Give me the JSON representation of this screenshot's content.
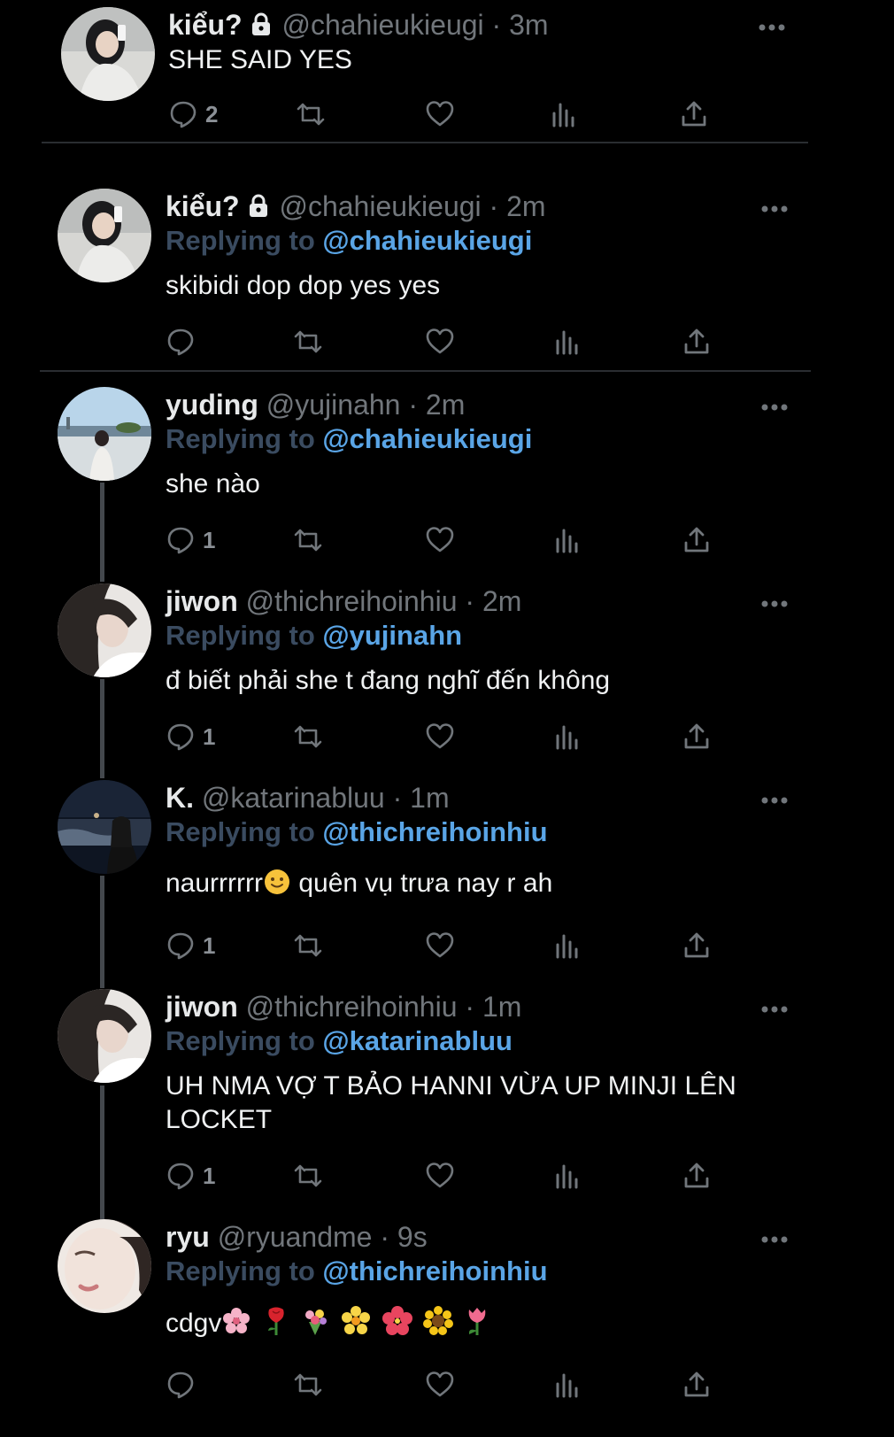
{
  "tweets": [
    {
      "name": "kiểu?",
      "locked": true,
      "handle": "@chahieukieugi",
      "sep": "·",
      "time": "3m",
      "replying_prefix": "",
      "replying_to": "",
      "text": "SHE SAID YES",
      "reply_count": "2"
    },
    {
      "name": "kiểu?",
      "locked": true,
      "handle": "@chahieukieugi",
      "sep": "·",
      "time": "2m",
      "replying_prefix": "Replying to",
      "replying_to": "@chahieukieugi",
      "text": "skibidi dop dop yes yes",
      "reply_count": ""
    },
    {
      "name": "yuding",
      "locked": false,
      "handle": "@yujinahn",
      "sep": "·",
      "time": "2m",
      "replying_prefix": "Replying to",
      "replying_to": "@chahieukieugi",
      "text": "she nào",
      "reply_count": "1"
    },
    {
      "name": "jiwon",
      "locked": false,
      "handle": "@thichreihoinhiu",
      "sep": "·",
      "time": "2m",
      "replying_prefix": "Replying to",
      "replying_to": "@yujinahn",
      "text": "đ biết phải she t đang nghĩ đến không",
      "reply_count": "1"
    },
    {
      "name": "K.",
      "locked": false,
      "handle": "@katarinabluu",
      "sep": "·",
      "time": "1m",
      "replying_prefix": "Replying to",
      "replying_to": "@thichreihoinhiu",
      "text_before_emoji": "naurrrrrr",
      "text_after_emoji": " quên vụ trưa nay r ah",
      "reply_count": "1"
    },
    {
      "name": "jiwon",
      "locked": false,
      "handle": "@thichreihoinhiu",
      "sep": "·",
      "time": "1m",
      "replying_prefix": "Replying to",
      "replying_to": "@katarinabluu",
      "text": "UH NMA VỢ T BẢO HANNI VỪA UP MINJI LÊN LOCKET",
      "reply_count": "1"
    },
    {
      "name": "ryu",
      "locked": false,
      "handle": "@ryuandme",
      "sep": "·",
      "time": "9s",
      "replying_prefix": "Replying to",
      "replying_to": "@thichreihoinhiu",
      "text_before_emoji": "cdgv",
      "emojis": [
        "cherry-blossom-icon",
        "rose-icon",
        "bouquet-icon",
        "blossom-icon",
        "hibiscus-icon",
        "sunflower-icon",
        "tulip-icon"
      ],
      "reply_count": ""
    }
  ],
  "colors": {
    "background": "#000000",
    "name": "#e7e9ea",
    "muted": "#71767b",
    "replying_prefix": "#3a4b60",
    "mention": "#5aa5e6"
  }
}
